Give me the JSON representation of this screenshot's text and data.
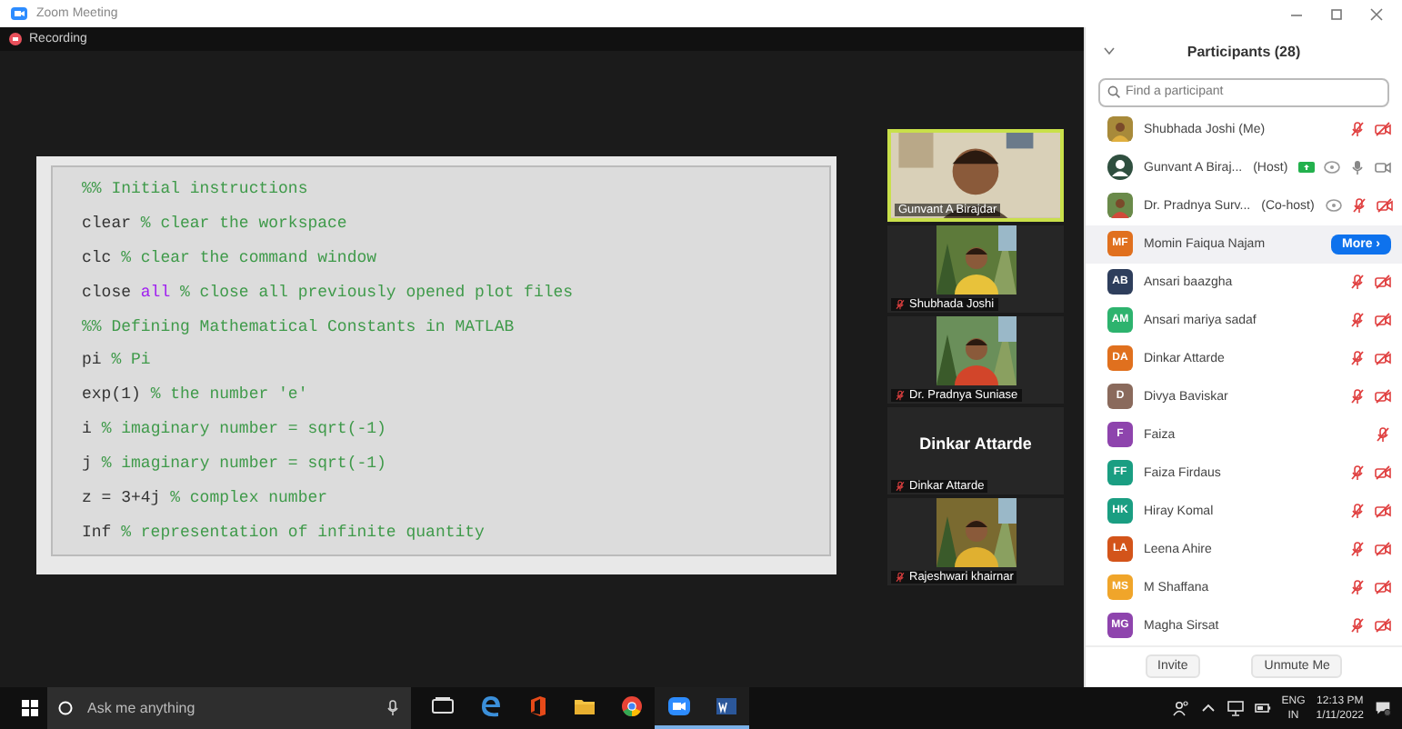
{
  "window": {
    "title": "Zoom Meeting"
  },
  "recording": {
    "label": "Recording"
  },
  "shared_screen": {
    "lines": [
      [
        {
          "kind": "comment",
          "text": "%% Initial instructions"
        }
      ],
      [
        {
          "kind": "code",
          "text": "clear "
        },
        {
          "kind": "comment",
          "text": "% clear the workspace"
        }
      ],
      [
        {
          "kind": "code",
          "text": "clc "
        },
        {
          "kind": "comment",
          "text": "% clear the command window"
        }
      ],
      [
        {
          "kind": "code",
          "text": "close "
        },
        {
          "kind": "keyword",
          "text": "all"
        },
        {
          "kind": "comment",
          "text": " % close all previously opened plot files"
        }
      ],
      [
        {
          "kind": "comment",
          "text": "%% Defining Mathematical Constants in MATLAB"
        }
      ],
      [
        {
          "kind": "code",
          "text": "pi "
        },
        {
          "kind": "comment",
          "text": "% Pi"
        }
      ],
      [
        {
          "kind": "code",
          "text": "exp(1) "
        },
        {
          "kind": "comment",
          "text": "% the number 'e'"
        }
      ],
      [
        {
          "kind": "code",
          "text": "i "
        },
        {
          "kind": "comment",
          "text": "% imaginary number = sqrt(-1)"
        }
      ],
      [
        {
          "kind": "code",
          "text": "j "
        },
        {
          "kind": "comment",
          "text": "% imaginary number = sqrt(-1)"
        }
      ],
      [
        {
          "kind": "code",
          "text": "z = 3+4j "
        },
        {
          "kind": "comment",
          "text": "% complex number"
        }
      ],
      [
        {
          "kind": "code",
          "text": "Inf "
        },
        {
          "kind": "comment",
          "text": "% representation of infinite quantity"
        }
      ]
    ]
  },
  "videos": [
    {
      "name": "Gunvant A Birajdar",
      "video": true,
      "speaking": true,
      "muted": false
    },
    {
      "name": "Shubhada Joshi",
      "video": true,
      "speaking": false,
      "muted": true
    },
    {
      "name": "Dr. Pradnya Suniase",
      "video": true,
      "speaking": false,
      "muted": true
    },
    {
      "name": "Dinkar Attarde",
      "display_name": "Dinkar Attarde",
      "video": false,
      "speaking": false,
      "muted": true
    },
    {
      "name": "Rajeshwari khairnar",
      "video": true,
      "speaking": false,
      "muted": true
    }
  ],
  "participants": {
    "title": "Participants (28)",
    "search_placeholder": "Find a participant",
    "items": [
      {
        "name": "Shubhada Joshi (Me)",
        "selected": false,
        "mic_muted": true,
        "video_off": true
      },
      {
        "name": "Gunvant A Biraj...",
        "role": "(Host)",
        "avatar": {
          "kind": "silhouette"
        },
        "selected": false,
        "sharing": true,
        "cc": true,
        "mic_muted": false,
        "video_off": false
      },
      {
        "name": "Dr. Pradnya Surv...",
        "role": "(Co-host)",
        "selected": false,
        "cc": true,
        "mic_muted": true,
        "video_off": true
      },
      {
        "name": "Momin Faiqua Najam",
        "avatar": {
          "kind": "initials",
          "initials": "MF",
          "color": "#e0701e"
        },
        "selected": true,
        "action": "More ›"
      },
      {
        "name": "Ansari baazgha",
        "avatar": {
          "kind": "initials",
          "initials": "AB",
          "color": "#2e3e5c"
        },
        "selected": false,
        "mic_muted": true,
        "video_off": true
      },
      {
        "name": "Ansari mariya sadaf",
        "avatar": {
          "kind": "initials",
          "initials": "AM",
          "color": "#2db36e"
        },
        "selected": false,
        "mic_muted": true,
        "video_off": true
      },
      {
        "name": "Dinkar Attarde",
        "avatar": {
          "kind": "initials",
          "initials": "DA",
          "color": "#e0701e"
        },
        "selected": false,
        "mic_muted": true,
        "video_off": true
      },
      {
        "name": "Divya Baviskar",
        "avatar": {
          "kind": "initials",
          "initials": "D",
          "color": "#8a6a5c"
        },
        "selected": false,
        "mic_muted": true,
        "video_off": true
      },
      {
        "name": "Faiza",
        "avatar": {
          "kind": "initials",
          "initials": "F",
          "color": "#8e44ad"
        },
        "selected": false,
        "mic_muted": true
      },
      {
        "name": "Faiza Firdaus",
        "avatar": {
          "kind": "initials",
          "initials": "FF",
          "color": "#1a9e82"
        },
        "selected": false,
        "mic_muted": true,
        "video_off": true
      },
      {
        "name": "Hiray Komal",
        "avatar": {
          "kind": "initials",
          "initials": "HK",
          "color": "#1a9e82"
        },
        "selected": false,
        "mic_muted": true,
        "video_off": true
      },
      {
        "name": "Leena Ahire",
        "avatar": {
          "kind": "initials",
          "initials": "LA",
          "color": "#d3541a"
        },
        "selected": false,
        "mic_muted": true,
        "video_off": true
      },
      {
        "name": "M Shaffana",
        "avatar": {
          "kind": "initials",
          "initials": "MS",
          "color": "#f0a52a"
        },
        "selected": false,
        "mic_muted": true,
        "video_off": true
      },
      {
        "name": "Magha Sirsat",
        "avatar": {
          "kind": "initials",
          "initials": "MG",
          "color": "#8e44ad"
        },
        "selected": false,
        "mic_muted": true,
        "video_off": true
      }
    ],
    "buttons": [
      "Invite",
      "Unmute Me"
    ]
  },
  "taskbar": {
    "search_placeholder": "Ask me anything",
    "apps": [
      {
        "kind": "taskview",
        "running": false
      },
      {
        "kind": "edge",
        "running": false
      },
      {
        "kind": "office",
        "running": false
      },
      {
        "kind": "explorer",
        "running": false
      },
      {
        "kind": "chrome",
        "running": false
      },
      {
        "kind": "zoom",
        "running": true
      },
      {
        "kind": "word",
        "running": true
      }
    ],
    "language": "ENG",
    "region": "IN",
    "time": "12:13 PM",
    "date": "1/11/2022"
  }
}
